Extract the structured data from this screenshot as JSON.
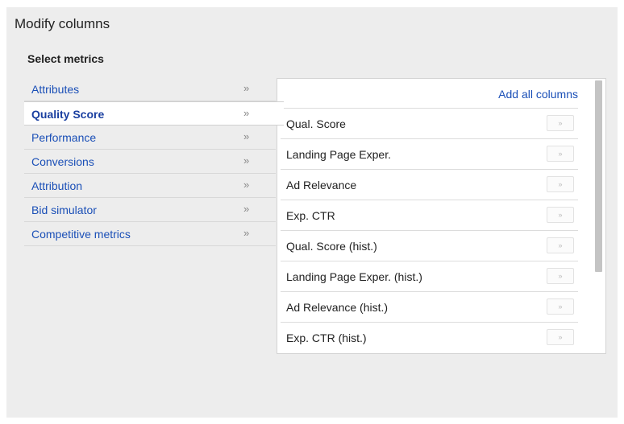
{
  "dialog": {
    "title": "Modify columns",
    "subtitle": "Select metrics"
  },
  "categories": [
    {
      "label": "Attributes",
      "chevron": "»",
      "selected": false
    },
    {
      "label": "Quality Score",
      "chevron": "»",
      "selected": true
    },
    {
      "label": "Performance",
      "chevron": "»",
      "selected": false
    },
    {
      "label": "Conversions",
      "chevron": "»",
      "selected": false
    },
    {
      "label": "Attribution",
      "chevron": "»",
      "selected": false
    },
    {
      "label": "Bid simulator",
      "chevron": "»",
      "selected": false
    },
    {
      "label": "Competitive metrics",
      "chevron": "»",
      "selected": false
    }
  ],
  "metrics": {
    "add_all_label": "Add all columns",
    "add_button_glyph": "»",
    "items": [
      "Qual. Score",
      "Landing Page Exper.",
      "Ad Relevance",
      "Exp. CTR",
      "Qual. Score (hist.)",
      "Landing Page Exper. (hist.)",
      "Ad Relevance (hist.)",
      "Exp. CTR (hist.)"
    ]
  },
  "colors": {
    "link": "#1a4fb7",
    "panel_bg": "#ededed",
    "scroll_thumb": "#c4c4c4"
  },
  "icons": {
    "category_chevron": "double-chevron-right-icon",
    "add_metric": "double-chevron-right-icon"
  }
}
